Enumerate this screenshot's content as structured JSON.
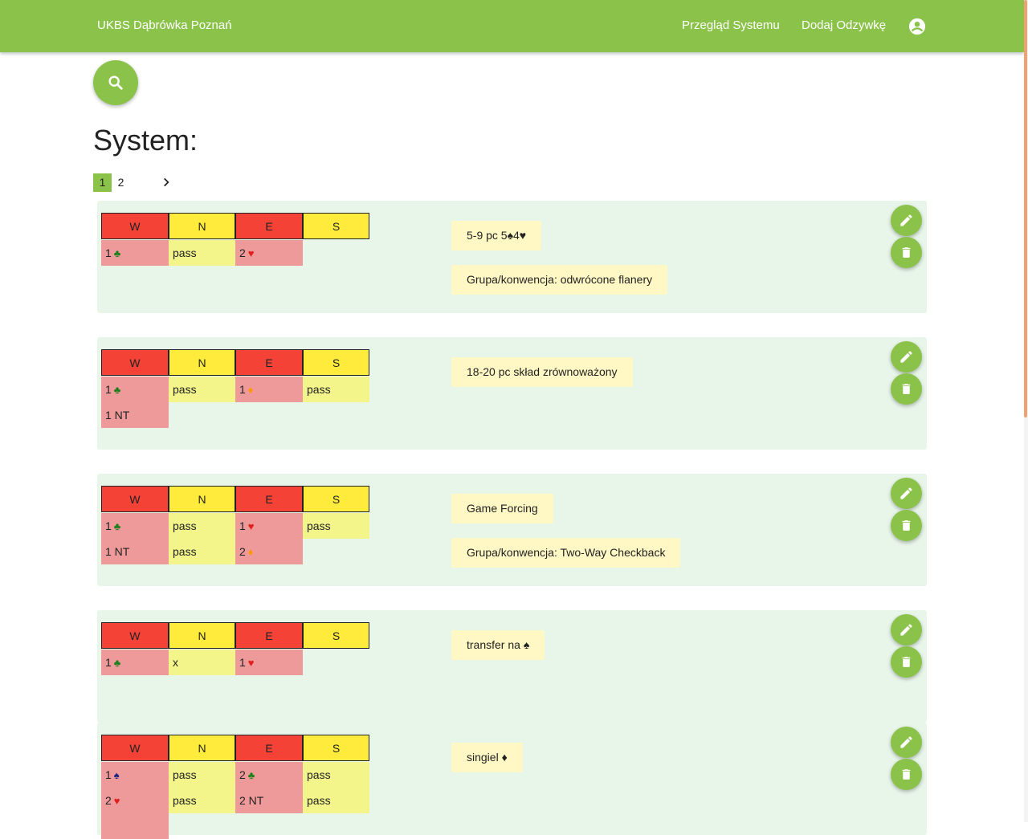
{
  "header": {
    "brand": "UKBS Dąbrówka Poznań",
    "nav": [
      {
        "label": "Przegląd Systemu"
      },
      {
        "label": "Dodaj Odzywkę"
      }
    ],
    "account_icon": "account-circle-icon"
  },
  "search_icon": "search-icon",
  "page_title": "System:",
  "pagination": {
    "pages": [
      "1",
      "2"
    ],
    "active": "1",
    "next_icon": "chevron-right-icon"
  },
  "table_headers": [
    "W",
    "N",
    "E",
    "S"
  ],
  "suit_colors": {
    "clubs": "#1b7f1b",
    "hearts": "#e0201c",
    "diamonds": "#ff9800",
    "spades": "#1a237e"
  },
  "colors": {
    "accent": "#8bc34a",
    "header_red": "#f44336",
    "header_yellow": "#ffeb3b",
    "cell_red": "#ef9a9a",
    "cell_yellow": "#f3f58a",
    "card_bg": "#e8f5e9",
    "tag_bg": "#fff8c4"
  },
  "entries": [
    {
      "rows": [
        [
          {
            "v": "1",
            "s": "♣",
            "c": "clubs"
          },
          {
            "v": "pass"
          },
          {
            "v": "2",
            "s": "♥",
            "c": "hearts"
          },
          null
        ]
      ],
      "tags": [
        "5-9 pc 5♠4♥",
        "Grupa/konwencja: odwrócone flanery"
      ]
    },
    {
      "rows": [
        [
          {
            "v": "1",
            "s": "♣",
            "c": "clubs"
          },
          {
            "v": "pass"
          },
          {
            "v": "1",
            "s": "♦",
            "c": "diamonds"
          },
          {
            "v": "pass"
          }
        ],
        [
          {
            "v": "1 NT"
          },
          null,
          null,
          null
        ]
      ],
      "tags": [
        "18-20 pc skład zrównoważony"
      ]
    },
    {
      "rows": [
        [
          {
            "v": "1",
            "s": "♣",
            "c": "clubs"
          },
          {
            "v": "pass"
          },
          {
            "v": "1",
            "s": "♥",
            "c": "hearts"
          },
          {
            "v": "pass"
          }
        ],
        [
          {
            "v": "1 NT"
          },
          {
            "v": "pass"
          },
          {
            "v": "2",
            "s": "♦",
            "c": "diamonds"
          },
          null
        ]
      ],
      "tags": [
        "Game Forcing",
        "Grupa/konwencja: Two-Way Checkback"
      ]
    },
    {
      "rows": [
        [
          {
            "v": "1",
            "s": "♣",
            "c": "clubs"
          },
          {
            "v": "x"
          },
          {
            "v": "1",
            "s": "♥",
            "c": "hearts"
          },
          null
        ]
      ],
      "tags": [
        "transfer na ♠"
      ]
    },
    {
      "rows": [
        [
          {
            "v": "1",
            "s": "♠",
            "c": "spades"
          },
          {
            "v": "pass"
          },
          {
            "v": "2",
            "s": "♣",
            "c": "clubs"
          },
          {
            "v": "pass"
          }
        ],
        [
          {
            "v": "2",
            "s": "♥",
            "c": "hearts"
          },
          {
            "v": "pass"
          },
          {
            "v": "2 NT"
          },
          {
            "v": "pass"
          }
        ],
        [
          {
            "v": ""
          },
          null,
          null,
          null
        ]
      ],
      "tags": [
        "singiel ♦"
      ]
    }
  ],
  "action_icons": {
    "edit": "pencil-icon",
    "delete": "trash-icon"
  }
}
